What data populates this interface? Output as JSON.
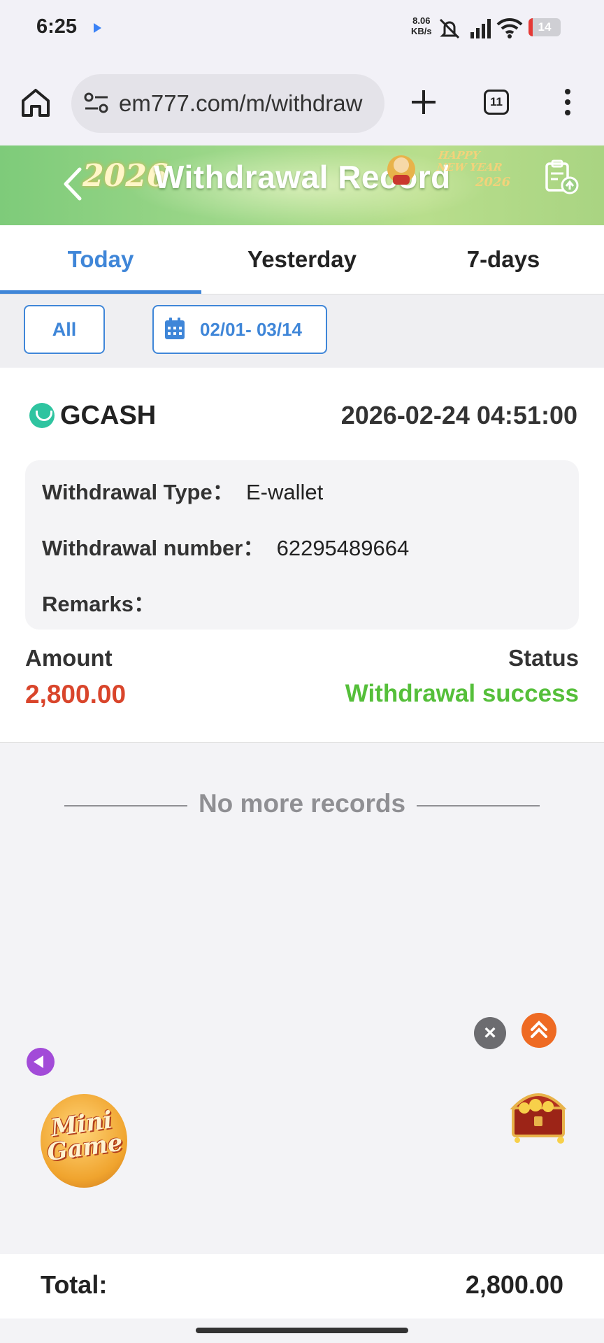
{
  "status_bar": {
    "time": "6:25",
    "net_speed_value": "8.06",
    "net_speed_unit": "KB/s",
    "battery": "14",
    "battery_level": 0.14
  },
  "browser": {
    "url": "em777.com/m/withdraw",
    "tab_count": "11"
  },
  "banner": {
    "title": "Withdrawal Record",
    "year_left": "2026",
    "happy": "HAPPY",
    "new_year": "NEW YEAR",
    "year_right": "2026"
  },
  "tabs": [
    {
      "label": "Today",
      "active": true
    },
    {
      "label": "Yesterday",
      "active": false
    },
    {
      "label": "7-days",
      "active": false
    }
  ],
  "filters": {
    "all_label": "All",
    "date_range": "02/01- 03/14"
  },
  "record": {
    "method": "GCASH",
    "time": "2026-02-24 04:51:00",
    "type_label": "Withdrawal Type：",
    "type_value": "E-wallet",
    "number_label": "Withdrawal number：",
    "number_value": "62295489664",
    "remarks_label": "Remarks：",
    "remarks_value": "",
    "amount_label": "Amount",
    "amount_value": "2,800.00",
    "status_label": "Status",
    "status_value": "Withdrawal success"
  },
  "list_end_text": "No more records",
  "floating": {
    "mini_game_text": "Mini Game"
  },
  "footer": {
    "total_label": "Total:",
    "total_value": "2,800.00"
  },
  "colors": {
    "accent": "#3f86d8",
    "amount": "#d9452b",
    "success": "#55bf3a"
  }
}
